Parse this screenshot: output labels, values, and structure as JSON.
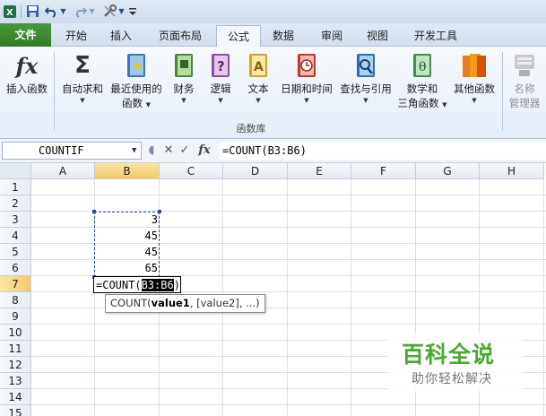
{
  "qat": {
    "icons": [
      "excel-logo-icon",
      "save-icon",
      "undo-icon",
      "redo-icon",
      "tools-icon",
      "customize-icon"
    ],
    "redo_disabled": true
  },
  "tabs": [
    "文件",
    "开始",
    "插入",
    "页面布局",
    "公式",
    "数据",
    "审阅",
    "视图",
    "开发工具"
  ],
  "active_tab": "公式",
  "ribbon": {
    "buttons": [
      {
        "label": "插入函数",
        "icon": "fx-icon"
      },
      {
        "label": "自动求和",
        "icon": "sigma-icon"
      },
      {
        "label": "最近使用的",
        "label2": "函数",
        "icon": "star-book-icon"
      },
      {
        "label": "财务",
        "icon": "finance-book-icon"
      },
      {
        "label": "逻辑",
        "icon": "logic-book-icon"
      },
      {
        "label": "文本",
        "icon": "text-book-icon"
      },
      {
        "label": "日期和时间",
        "icon": "datetime-book-icon"
      },
      {
        "label": "查找与引用",
        "icon": "lookup-book-icon"
      },
      {
        "label": "数学和",
        "label2": "三角函数",
        "icon": "theta-book-icon"
      },
      {
        "label": "其他函数",
        "icon": "more-books-icon"
      },
      {
        "label": "名称",
        "label2": "管理器",
        "icon": "name-manager-icon",
        "disabled": true
      }
    ],
    "group_label": "函数库"
  },
  "formula_bar": {
    "name_box": "COUNTIF",
    "fx": "fx",
    "formula": "=COUNT(B3:B6)"
  },
  "grid": {
    "columns": [
      "A",
      "B",
      "C",
      "D",
      "E",
      "F",
      "G",
      "H"
    ],
    "rows": [
      "1",
      "2",
      "3",
      "4",
      "5",
      "6",
      "7",
      "8",
      "9",
      "10",
      "11",
      "12",
      "13",
      "14",
      "15"
    ],
    "selected_column": "B",
    "selected_row": "7",
    "cells": {
      "B3": "3",
      "B4": "45",
      "B5": "45",
      "B6": "65"
    },
    "edit_cell": {
      "address": "B7",
      "prefix": "=COUNT(",
      "ref": "B3:B6",
      "suffix": ")"
    },
    "tooltip": {
      "fn": "COUNT(",
      "arg1": "value1",
      "rest": ", [value2], ...)"
    }
  },
  "watermark": {
    "title": "百科全说",
    "subtitle": "助你轻松解决"
  },
  "colors": {
    "file_tab": "#2f7d27",
    "selection_header": "#f5c96c",
    "range_border": "#2a4d9e",
    "watermark_green": "#4ba82e"
  }
}
